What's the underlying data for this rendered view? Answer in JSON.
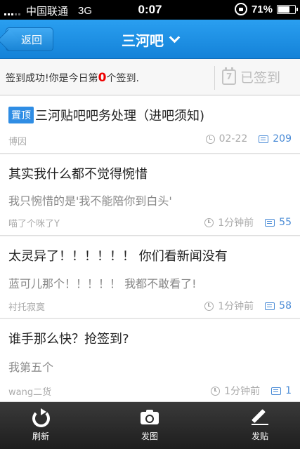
{
  "status_bar": {
    "carrier": "中国联通",
    "network": "3G",
    "time": "0:07",
    "battery": "71%",
    "battery_level": 0.71
  },
  "header": {
    "back_label": "返回",
    "title": "三河吧"
  },
  "sign_bar": {
    "message_prefix": "签到成功!你是今日第",
    "rank": "0",
    "message_suffix": "个签到.",
    "button_label": "已签到"
  },
  "posts": [
    {
      "pin_label": "置顶",
      "title": "三河贴吧吧务处理（进吧须知)",
      "author": "博因",
      "time": "02-22",
      "replies": "209"
    },
    {
      "title": "其实我什么都不觉得惋惜",
      "excerpt": "我只惋惜的是'我不能陪你到白头'",
      "author": "喵了个咪了Y",
      "time": "1分钟前",
      "replies": "55"
    },
    {
      "title": "太灵异了！！！！！！ 你们看新闻没有",
      "excerpt": "蓝可儿那个！！！！！ 我都不敢看了!",
      "author": "衬托寂寞",
      "time": "1分钟前",
      "replies": "58"
    },
    {
      "title": "谁手那么快？抢签到?",
      "excerpt": "我第五个",
      "author": "wang二货",
      "time": "1分钟前",
      "replies": "1"
    }
  ],
  "toolbar": {
    "refresh_label": "刷新",
    "photo_label": "发图",
    "post_label": "发贴"
  }
}
